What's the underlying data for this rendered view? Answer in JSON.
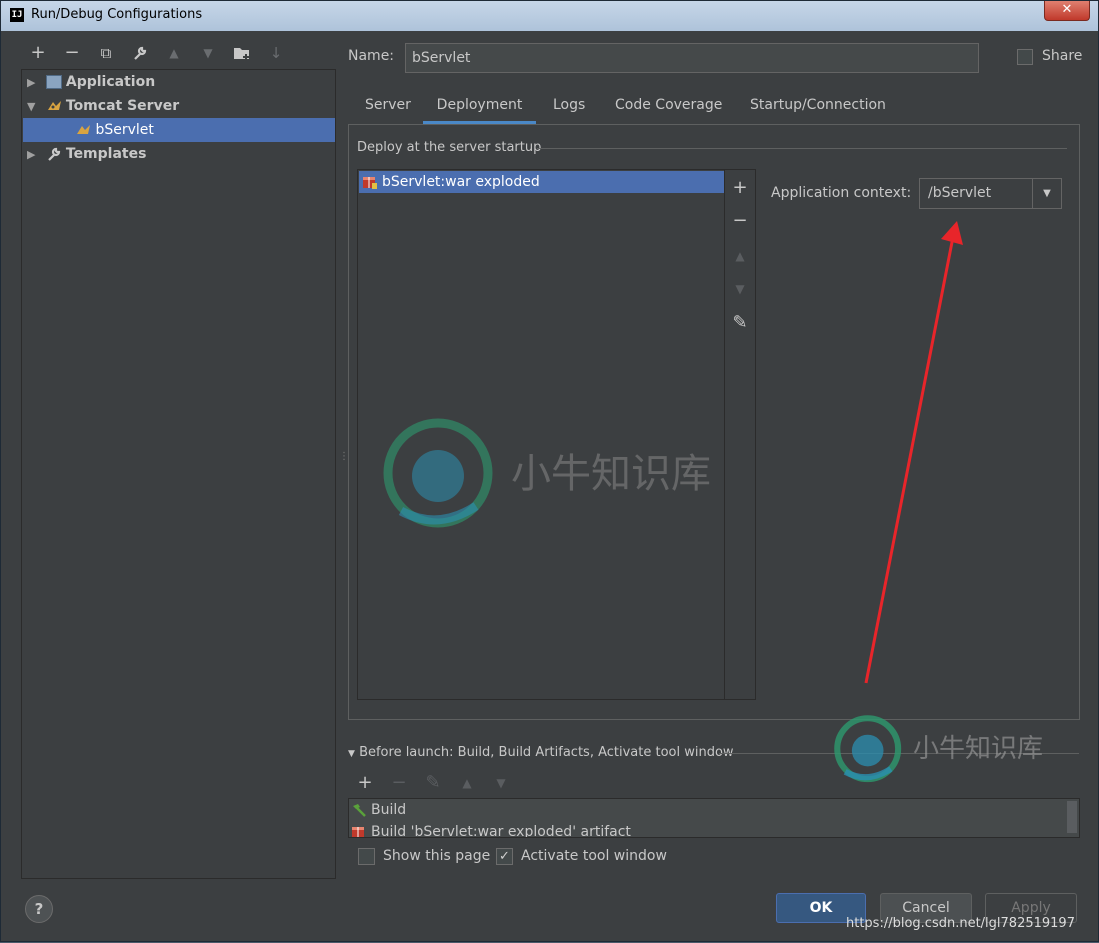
{
  "window": {
    "title": "Run/Debug Configurations",
    "close_glyph": "✕",
    "app_icon": "IJ"
  },
  "left_toolbar": {
    "icons": [
      "add-icon",
      "remove-icon",
      "copy-icon",
      "wrench-icon",
      "move-up-icon",
      "move-down-icon",
      "folder-add-icon",
      "sort-icon"
    ],
    "glyphs": {
      "add": "+",
      "remove": "−",
      "copy": "⧉",
      "wrench": "🔧",
      "up": "▲",
      "down": "▼",
      "folder": "▆",
      "sort": "↓"
    }
  },
  "tree": {
    "application": {
      "label": "Application",
      "arrow": "▶"
    },
    "tomcat": {
      "label": "Tomcat Server",
      "arrow": "▼"
    },
    "bservlet": {
      "label": "bServlet"
    },
    "templates": {
      "label": "Templates",
      "arrow": "▶"
    }
  },
  "name": {
    "label": "Name:",
    "value": "bServlet"
  },
  "share": {
    "label": "Share",
    "checked": false
  },
  "tabs": [
    "Server",
    "Deployment",
    "Logs",
    "Code Coverage",
    "Startup/Connection"
  ],
  "active_tab": "Deployment",
  "deployment": {
    "group_label": "Deploy at the server startup",
    "items": [
      "bServlet:war exploded"
    ],
    "tools": {
      "add": "+",
      "remove": "−",
      "up": "▲",
      "down": "▼",
      "edit": "✎"
    },
    "context_label": "Application context:",
    "context_value": "/bServlet",
    "combo_arrow": "▼"
  },
  "before_launch": {
    "label": "Before launch: Build, Build Artifacts, Activate tool window",
    "arrow": "▼",
    "tools": {
      "add": "+",
      "remove": "−",
      "edit": "✎",
      "up": "▲",
      "down": "▼"
    },
    "rows": [
      "Build",
      "Build 'bServlet:war exploded' artifact"
    ]
  },
  "options": {
    "show_page": {
      "label": "Show this page",
      "checked": false
    },
    "activate_tool": {
      "label": "Activate tool window",
      "checked": true,
      "mark": "✓"
    }
  },
  "buttons": {
    "help": "?",
    "ok": "OK",
    "cancel": "Cancel",
    "apply": "Apply"
  },
  "overlay": {
    "watermark_text": "小牛知识库",
    "url": "https://blog.csdn.net/lgl782519197"
  },
  "colors": {
    "bg": "#3c3f41",
    "selection": "#4b6eaf",
    "arrow": "#e8252a"
  }
}
